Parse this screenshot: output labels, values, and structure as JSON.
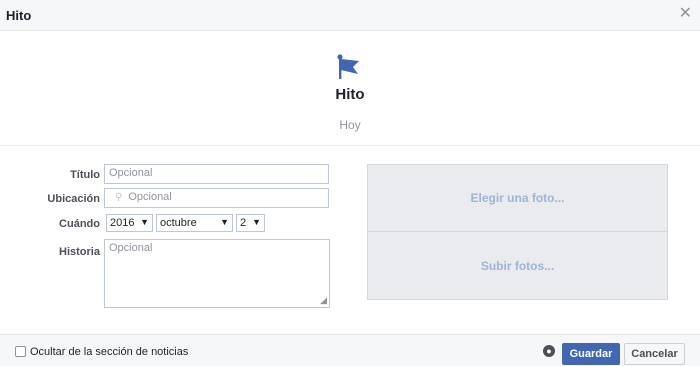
{
  "dialog": {
    "title": "Hito",
    "close_icon": "close-icon"
  },
  "hero": {
    "title": "Hito",
    "subtitle": "Hoy",
    "icon": "flag-icon",
    "icon_color": "#4267b2"
  },
  "form": {
    "title_label": "Título",
    "title_placeholder": "Opcional",
    "location_label": "Ubicación",
    "location_placeholder": "Opcional",
    "when_label": "Cuándo",
    "year": "2016",
    "month": "octubre",
    "day": "2",
    "story_label": "Historia",
    "story_placeholder": "Opcional"
  },
  "photos": {
    "choose": "Elegir una foto...",
    "upload": "Subir fotos..."
  },
  "footer": {
    "hide_label": "Ocultar de la sección de noticias",
    "hide_checked": false,
    "save": "Guardar",
    "cancel": "Cancelar",
    "accent": "#4267b2"
  }
}
